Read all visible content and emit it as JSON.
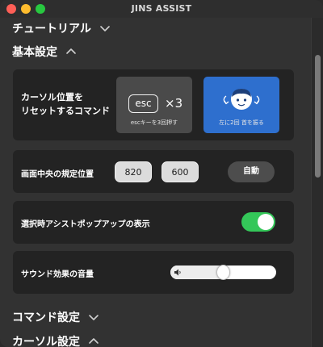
{
  "app": {
    "title": "JINS ASSIST"
  },
  "sections": {
    "tutorial": {
      "label": "チュートリアル",
      "expanded": false
    },
    "basic": {
      "label": "基本設定",
      "expanded": true
    },
    "commands": {
      "label": "コマンド設定",
      "expanded": false
    },
    "cursor": {
      "label": "カーソル設定",
      "expanded": true
    }
  },
  "cursor_reset": {
    "label_line1": "カーソル位置を",
    "label_line2": "リセットするコマンド",
    "esc_option": {
      "key": "esc",
      "times": "×3",
      "caption": "escキーを3回押す",
      "selected": false
    },
    "head_option": {
      "caption": "左に2回 首を振る",
      "selected": true,
      "icon": "head-shake-icon"
    }
  },
  "center_position": {
    "label": "画面中央の規定位置",
    "x": "820",
    "y": "600",
    "auto_label": "自動"
  },
  "assist_popup": {
    "label": "選択時アシストポップアップの表示",
    "enabled": true
  },
  "sound": {
    "label": "サウンド効果の音量",
    "volume": 0.5,
    "icon": "speaker-icon"
  },
  "colors": {
    "accent_blue": "#2e6fce",
    "toggle_green": "#34c759"
  }
}
